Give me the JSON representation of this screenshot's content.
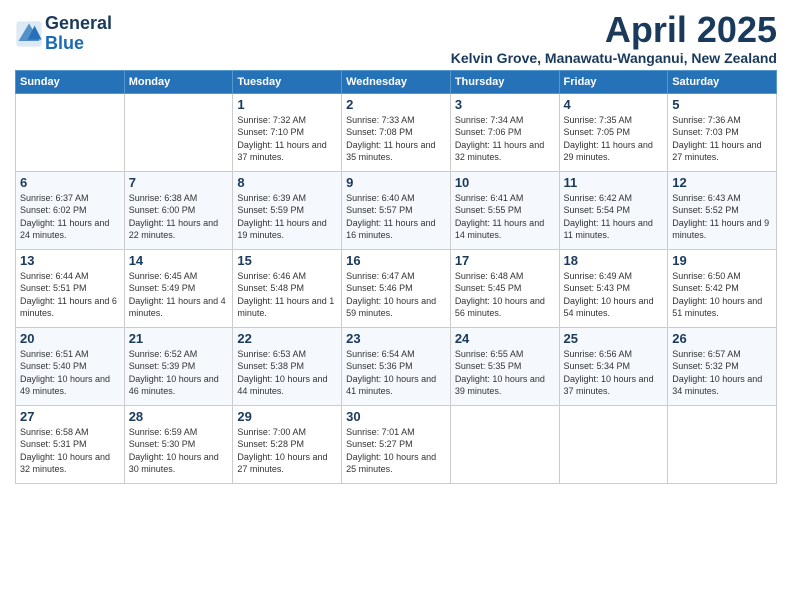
{
  "logo": {
    "line1": "General",
    "line2": "Blue"
  },
  "title": "April 2025",
  "location": "Kelvin Grove, Manawatu-Wanganui, New Zealand",
  "days_of_week": [
    "Sunday",
    "Monday",
    "Tuesday",
    "Wednesday",
    "Thursday",
    "Friday",
    "Saturday"
  ],
  "weeks": [
    [
      {
        "day": "",
        "info": ""
      },
      {
        "day": "",
        "info": ""
      },
      {
        "day": "1",
        "info": "Sunrise: 7:32 AM\nSunset: 7:10 PM\nDaylight: 11 hours and 37 minutes."
      },
      {
        "day": "2",
        "info": "Sunrise: 7:33 AM\nSunset: 7:08 PM\nDaylight: 11 hours and 35 minutes."
      },
      {
        "day": "3",
        "info": "Sunrise: 7:34 AM\nSunset: 7:06 PM\nDaylight: 11 hours and 32 minutes."
      },
      {
        "day": "4",
        "info": "Sunrise: 7:35 AM\nSunset: 7:05 PM\nDaylight: 11 hours and 29 minutes."
      },
      {
        "day": "5",
        "info": "Sunrise: 7:36 AM\nSunset: 7:03 PM\nDaylight: 11 hours and 27 minutes."
      }
    ],
    [
      {
        "day": "6",
        "info": "Sunrise: 6:37 AM\nSunset: 6:02 PM\nDaylight: 11 hours and 24 minutes."
      },
      {
        "day": "7",
        "info": "Sunrise: 6:38 AM\nSunset: 6:00 PM\nDaylight: 11 hours and 22 minutes."
      },
      {
        "day": "8",
        "info": "Sunrise: 6:39 AM\nSunset: 5:59 PM\nDaylight: 11 hours and 19 minutes."
      },
      {
        "day": "9",
        "info": "Sunrise: 6:40 AM\nSunset: 5:57 PM\nDaylight: 11 hours and 16 minutes."
      },
      {
        "day": "10",
        "info": "Sunrise: 6:41 AM\nSunset: 5:55 PM\nDaylight: 11 hours and 14 minutes."
      },
      {
        "day": "11",
        "info": "Sunrise: 6:42 AM\nSunset: 5:54 PM\nDaylight: 11 hours and 11 minutes."
      },
      {
        "day": "12",
        "info": "Sunrise: 6:43 AM\nSunset: 5:52 PM\nDaylight: 11 hours and 9 minutes."
      }
    ],
    [
      {
        "day": "13",
        "info": "Sunrise: 6:44 AM\nSunset: 5:51 PM\nDaylight: 11 hours and 6 minutes."
      },
      {
        "day": "14",
        "info": "Sunrise: 6:45 AM\nSunset: 5:49 PM\nDaylight: 11 hours and 4 minutes."
      },
      {
        "day": "15",
        "info": "Sunrise: 6:46 AM\nSunset: 5:48 PM\nDaylight: 11 hours and 1 minute."
      },
      {
        "day": "16",
        "info": "Sunrise: 6:47 AM\nSunset: 5:46 PM\nDaylight: 10 hours and 59 minutes."
      },
      {
        "day": "17",
        "info": "Sunrise: 6:48 AM\nSunset: 5:45 PM\nDaylight: 10 hours and 56 minutes."
      },
      {
        "day": "18",
        "info": "Sunrise: 6:49 AM\nSunset: 5:43 PM\nDaylight: 10 hours and 54 minutes."
      },
      {
        "day": "19",
        "info": "Sunrise: 6:50 AM\nSunset: 5:42 PM\nDaylight: 10 hours and 51 minutes."
      }
    ],
    [
      {
        "day": "20",
        "info": "Sunrise: 6:51 AM\nSunset: 5:40 PM\nDaylight: 10 hours and 49 minutes."
      },
      {
        "day": "21",
        "info": "Sunrise: 6:52 AM\nSunset: 5:39 PM\nDaylight: 10 hours and 46 minutes."
      },
      {
        "day": "22",
        "info": "Sunrise: 6:53 AM\nSunset: 5:38 PM\nDaylight: 10 hours and 44 minutes."
      },
      {
        "day": "23",
        "info": "Sunrise: 6:54 AM\nSunset: 5:36 PM\nDaylight: 10 hours and 41 minutes."
      },
      {
        "day": "24",
        "info": "Sunrise: 6:55 AM\nSunset: 5:35 PM\nDaylight: 10 hours and 39 minutes."
      },
      {
        "day": "25",
        "info": "Sunrise: 6:56 AM\nSunset: 5:34 PM\nDaylight: 10 hours and 37 minutes."
      },
      {
        "day": "26",
        "info": "Sunrise: 6:57 AM\nSunset: 5:32 PM\nDaylight: 10 hours and 34 minutes."
      }
    ],
    [
      {
        "day": "27",
        "info": "Sunrise: 6:58 AM\nSunset: 5:31 PM\nDaylight: 10 hours and 32 minutes."
      },
      {
        "day": "28",
        "info": "Sunrise: 6:59 AM\nSunset: 5:30 PM\nDaylight: 10 hours and 30 minutes."
      },
      {
        "day": "29",
        "info": "Sunrise: 7:00 AM\nSunset: 5:28 PM\nDaylight: 10 hours and 27 minutes."
      },
      {
        "day": "30",
        "info": "Sunrise: 7:01 AM\nSunset: 5:27 PM\nDaylight: 10 hours and 25 minutes."
      },
      {
        "day": "",
        "info": ""
      },
      {
        "day": "",
        "info": ""
      },
      {
        "day": "",
        "info": ""
      }
    ]
  ]
}
